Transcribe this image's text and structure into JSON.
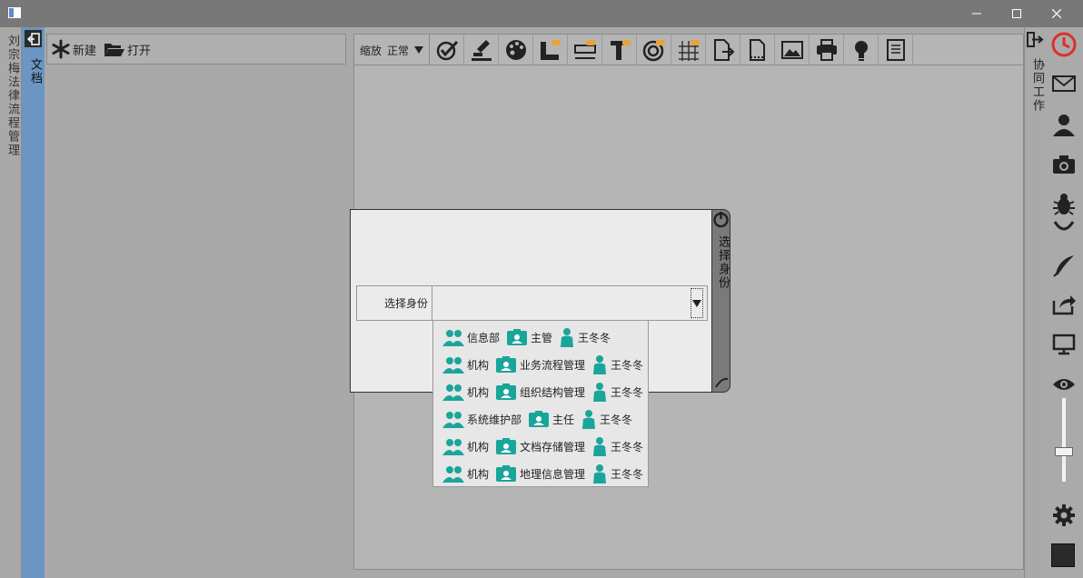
{
  "window": {
    "minimize": "—",
    "maximize": "☐",
    "close": "✕"
  },
  "left_tab": {
    "label": "刘宗梅法律流程管理"
  },
  "doc_column": {
    "label": "文档"
  },
  "file_toolbar": {
    "new_label": "新建",
    "open_label": "打开"
  },
  "main_toolbar": {
    "zoom_label": "缩放",
    "zoom_value": "正常",
    "tools": [
      "check-icon",
      "stamp-icon",
      "palette-icon",
      "ruler-icon",
      "field-icon",
      "text-icon",
      "target-icon",
      "grid-icon",
      "export-icon",
      "page-icon",
      "image-icon",
      "print-icon",
      "bulb-icon",
      "doc-icon"
    ]
  },
  "dialog": {
    "side_label": "选择身份",
    "field_label": "选择身份",
    "selected_value": ""
  },
  "identities": [
    {
      "org": "信息部",
      "role": "主管",
      "person": "王冬冬"
    },
    {
      "org": "机构",
      "role": "业务流程管理",
      "person": "王冬冬"
    },
    {
      "org": "机构",
      "role": "组织结构管理",
      "person": "王冬冬"
    },
    {
      "org": "系统维护部",
      "role": "主任",
      "person": "王冬冬"
    },
    {
      "org": "机构",
      "role": "文档存储管理",
      "person": "王冬冬"
    },
    {
      "org": "机构",
      "role": "地理信息管理",
      "person": "王冬冬"
    }
  ],
  "right_tab": {
    "label": "协同工作"
  },
  "colors": {
    "accent_teal": "#1aa59a",
    "doc_blue": "#6b95c3",
    "clock_red": "#d9312b"
  }
}
